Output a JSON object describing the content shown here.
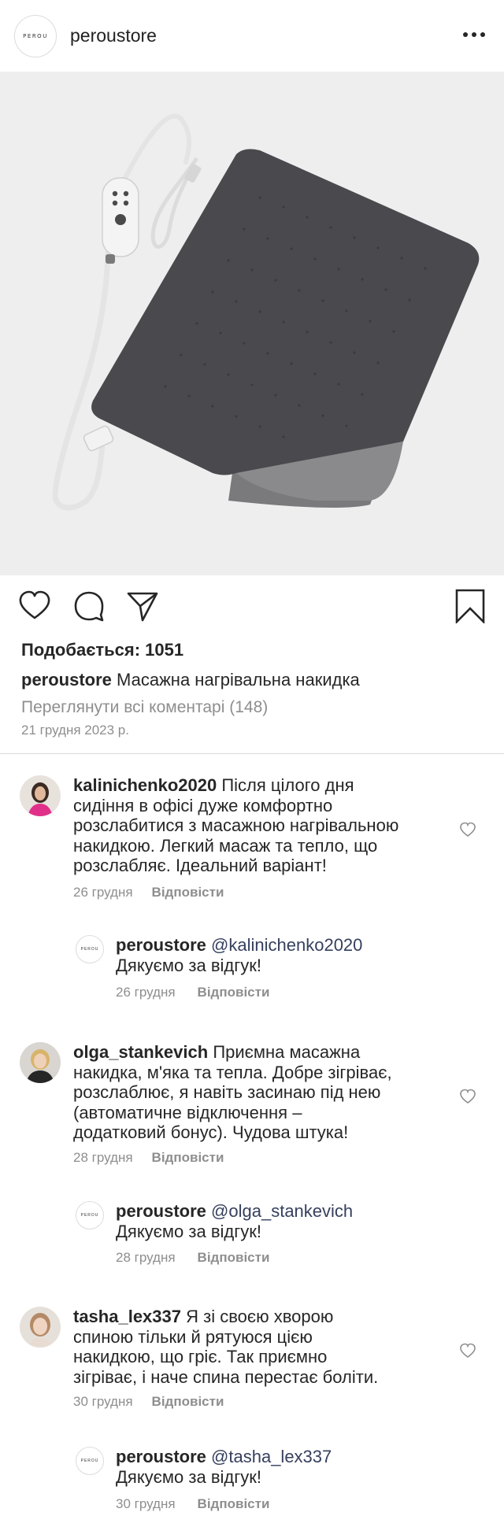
{
  "header": {
    "logo_text": "PEROU",
    "username": "peroustore"
  },
  "post": {
    "image_alt": "heating-pad",
    "likes": "Подобається: 1051",
    "caption_user": "peroustore",
    "caption_text": "Масажна нагрівальна накидка",
    "view_all": "Переглянути всі коментарі (148)",
    "date": "21 грудня 2023 р."
  },
  "comments": [
    {
      "user": "kalinichenko2020",
      "lines": [
        "Після цілого дня",
        "сидіння в офісі дуже комфортно",
        "розслабитися з масажною нагрівальною",
        "накидкою. Легкий масаж та тепло, що",
        "розслабляє. Ідеальний варіант!"
      ],
      "date": "26 грудня",
      "reply_label": "Відповісти",
      "reply": {
        "user": "peroustore",
        "mention": "@kalinichenko2020",
        "text": "Дякуємо за відгук!",
        "date": "26 грудня",
        "reply_label": "Відповісти"
      }
    },
    {
      "user": "olga_stankevich",
      "lines": [
        "Приємна масажна",
        "накидка, м'яка та тепла. Добре зігріває,",
        "розслаблює, я навіть засинаю під нею",
        "(автоматичне відключення –",
        "додатковий бонус). Чудова штука!"
      ],
      "date": "28 грудня",
      "reply_label": "Відповісти",
      "reply": {
        "user": "peroustore",
        "mention": "@olga_stankevich",
        "text": "Дякуємо за відгук!",
        "date": "28 грудня",
        "reply_label": "Відповісти"
      }
    },
    {
      "user": "tasha_lex337",
      "lines": [
        "Я зі своєю хворою",
        "спиною тільки й рятуюся цією",
        "накидкою, що гріє. Так приємно",
        "зігріває, і наче спина перестає боліти."
      ],
      "date": "30 грудня",
      "reply_label": "Відповісти",
      "reply": {
        "user": "peroustore",
        "mention": "@tasha_lex337",
        "text": "Дякуємо за відгук!",
        "date": "30 грудня",
        "reply_label": "Відповісти"
      }
    }
  ],
  "icons": [
    "more-icon",
    "heart-icon",
    "comment-icon",
    "share-icon",
    "bookmark-icon",
    "small-heart-icon"
  ],
  "colors": {
    "text": "#262626",
    "muted": "#8e8e8e",
    "mention": "#36405e",
    "image_bg": "#eeeeee"
  }
}
